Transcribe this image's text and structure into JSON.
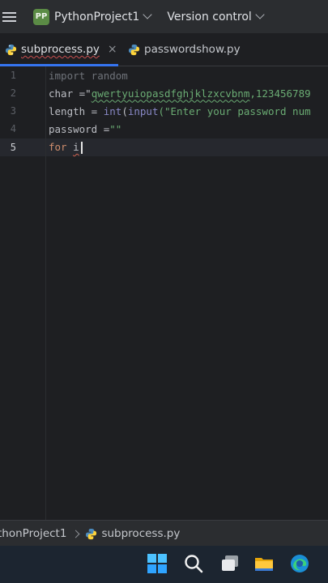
{
  "titlebar": {
    "project_badge": "PP",
    "project_name": "PythonProject1",
    "version_control": "Version control"
  },
  "tabs": [
    {
      "label": "subprocess.py",
      "active": true,
      "close": "×"
    },
    {
      "label": "passwordshow.py",
      "active": false
    }
  ],
  "editor": {
    "lines": [
      {
        "number": "1",
        "parts": [
          "import random"
        ]
      },
      {
        "number": "2",
        "parts": [
          "char =\"",
          "qwertyuiopasdfghjklzxcvbnm",
          ",123456789"
        ]
      },
      {
        "number": "3",
        "parts": [
          "length = ",
          "int",
          "(",
          "input",
          "(\"Enter your password num"
        ]
      },
      {
        "number": "4",
        "parts": [
          "password =",
          "\"\""
        ]
      },
      {
        "number": "5",
        "parts": [
          "for",
          " ",
          "i"
        ]
      }
    ],
    "current_line": "5"
  },
  "breadcrumb": {
    "project": "thonProject1",
    "file": "subprocess.py"
  },
  "taskbar": {
    "icons": [
      "windows-start-icon",
      "search-icon",
      "task-view-icon",
      "file-explorer-icon",
      "edge-browser-icon"
    ]
  },
  "colors": {
    "accent": "#3574f0",
    "keyword": "#cf8e6d",
    "string": "#6aab73",
    "builtin": "#8888c6",
    "badge": "#5b8b45"
  }
}
